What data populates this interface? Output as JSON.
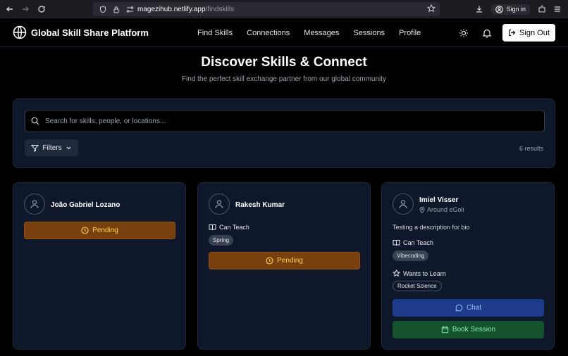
{
  "browser": {
    "url_host": "magezihub.netlify.app",
    "url_path": "/findskills",
    "signin_label": "Sign in"
  },
  "header": {
    "brand": "Global Skill Share Platform",
    "nav": [
      "Find Skills",
      "Connections",
      "Messages",
      "Sessions",
      "Profile"
    ],
    "signout_label": "Sign Out"
  },
  "hero": {
    "title": "Discover Skills & Connect",
    "subtitle": "Find the perfect skill exchange partner from our global community"
  },
  "search": {
    "placeholder": "Search for skills, people, or locations...",
    "filters_label": "Filters",
    "results": "6 results"
  },
  "cards": [
    {
      "name": "João Gabriel Lozano",
      "status": "Pending"
    },
    {
      "name": "Rakesh Kumar",
      "can_teach_label": "Can Teach",
      "teach_skills": [
        "Spring"
      ],
      "status": "Pending"
    },
    {
      "name": "Imiel Visser",
      "location": "Around eGoli",
      "bio": "Testing a description for bio",
      "can_teach_label": "Can Teach",
      "teach_skills": [
        "Vibecoding"
      ],
      "wants_label": "Wants to Learn",
      "learn_skills": [
        "Rocket Science"
      ],
      "chat_label": "Chat",
      "book_label": "Book Session"
    }
  ],
  "colors": {
    "card_bg": "#0f172a",
    "pending_bg": "#78400f",
    "pending_text": "#fcd34d",
    "chat_bg": "#1e3a8a",
    "book_bg": "#14532d"
  }
}
